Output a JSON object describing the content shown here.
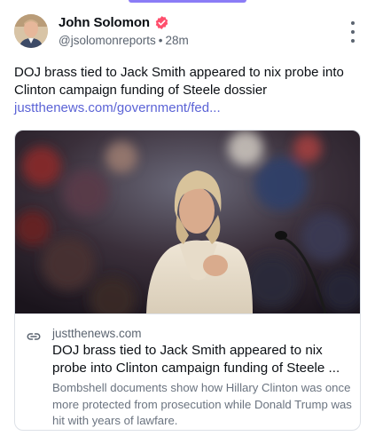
{
  "post": {
    "author_name": "John Solomon",
    "handle": "@jsolomonreports",
    "separator": "•",
    "time": "28m",
    "text": "DOJ brass tied to Jack Smith appeared to nix probe into Clinton campaign funding of Steele dossier",
    "link_text": "justthenews.com/government/fed..."
  },
  "card": {
    "domain": "justthenews.com",
    "title": "DOJ brass tied to Jack Smith appeared to nix probe into Clinton campaign funding of Steele ...",
    "description": "Bombshell documents show how Hillary Clinton was once more protected from prosecution while Donald Trump was hit with years of lawfare."
  },
  "icons": {
    "verified": "verified-badge-icon",
    "more": "more-vertical-icon",
    "link": "link-icon"
  },
  "colors": {
    "accent": "#8b7cf6",
    "verified": "#ff4f6d",
    "link": "#5b63d6",
    "muted": "#5b6470"
  }
}
